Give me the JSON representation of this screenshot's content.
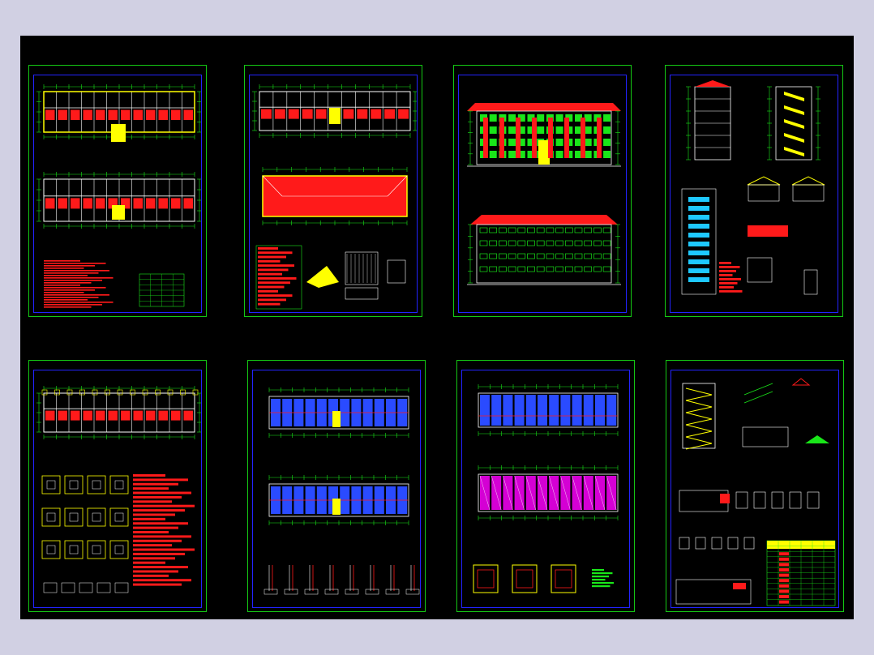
{
  "window": {
    "title": ""
  },
  "drawing_set": {
    "caption_top": [
      "",
      ""
    ],
    "caption_sheet3": [
      "",
      ""
    ],
    "sheets": [
      {
        "id": "s1",
        "kind": "floor-plans"
      },
      {
        "id": "s2",
        "kind": "roof-and-details"
      },
      {
        "id": "s3",
        "kind": "elevations"
      },
      {
        "id": "s4",
        "kind": "sections-and-details"
      },
      {
        "id": "s5",
        "kind": "foundation-plan"
      },
      {
        "id": "s6",
        "kind": "structural-plans"
      },
      {
        "id": "s7",
        "kind": "slab-plans"
      },
      {
        "id": "s8",
        "kind": "stair-details-and-tables"
      }
    ]
  },
  "colors": {
    "background": "#d1d0e3",
    "canvas": "#000000",
    "sheet_border": "#14c814",
    "inner_border": "#2323ff",
    "annotation": "#ff1a1a",
    "dimension": "#19e619",
    "fill_yellow": "#ffff00",
    "fill_blue": "#2a4bff",
    "fill_magenta": "#d400d4",
    "linework": "#ffffff"
  }
}
